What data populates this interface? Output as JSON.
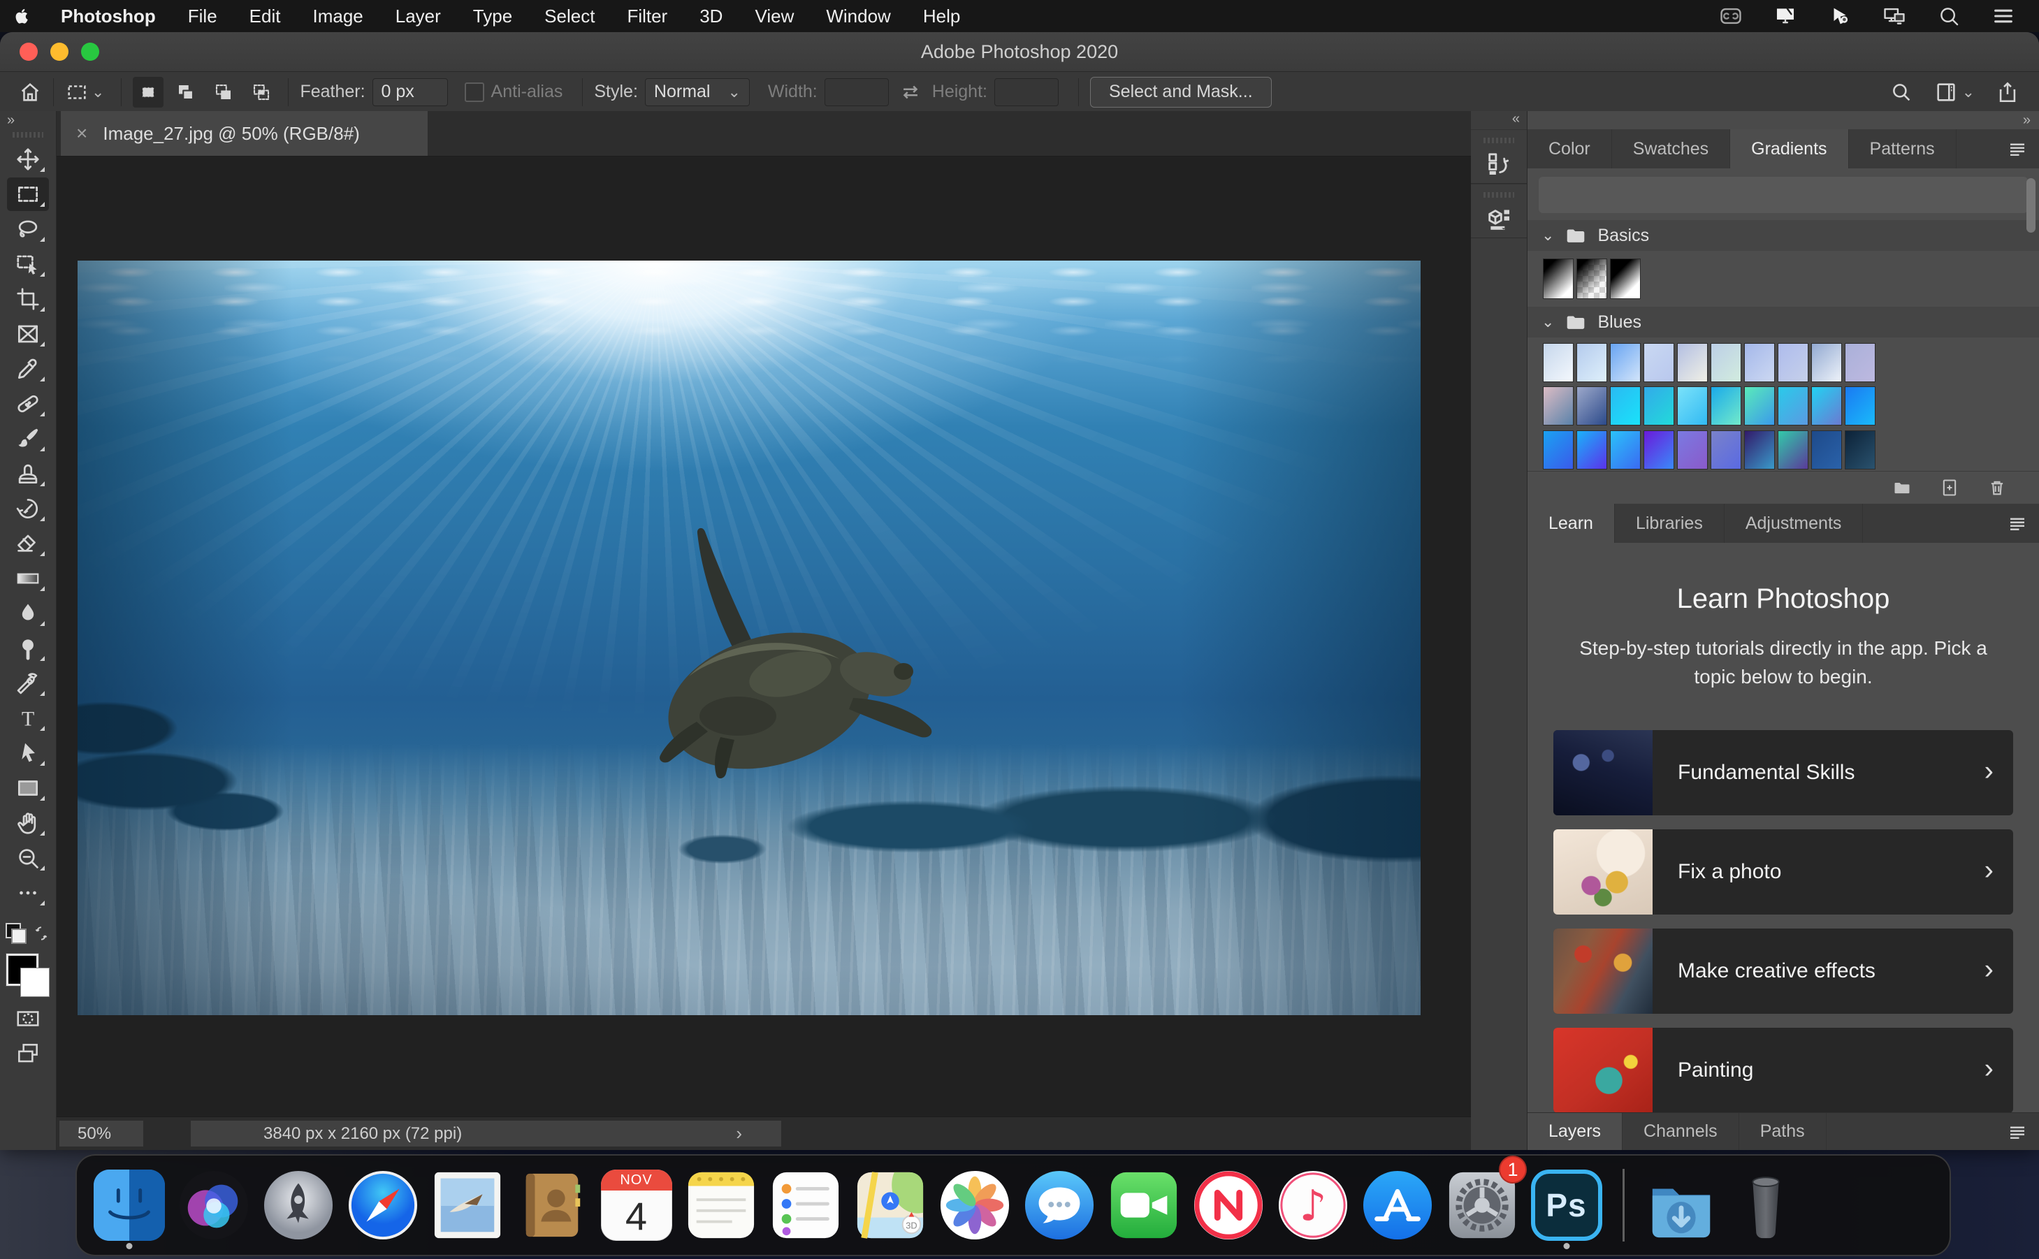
{
  "menubar": {
    "items": [
      "Photoshop",
      "File",
      "Edit",
      "Image",
      "Layer",
      "Type",
      "Select",
      "Filter",
      "3D",
      "View",
      "Window",
      "Help"
    ],
    "status_icons": [
      "creative-cloud-icon",
      "display-mirroring-icon",
      "pen-input-icon",
      "external-displays-icon",
      "spotlight-search-icon",
      "notification-list-icon"
    ]
  },
  "titlebar": {
    "title": "Adobe Photoshop 2020"
  },
  "optionsbar": {
    "feather_label": "Feather:",
    "feather_value": "0 px",
    "antialias_label": "Anti-alias",
    "style_label": "Style:",
    "style_value": "Normal",
    "width_label": "Width:",
    "height_label": "Height:",
    "select_and_mask_label": "Select and Mask...",
    "selection_modes": [
      "new-selection",
      "add-to-selection",
      "subtract-from-selection",
      "intersect-selection"
    ]
  },
  "document": {
    "tab_title": "Image_27.jpg @ 50% (RGB/8#)",
    "close_glyph": "×"
  },
  "toolbar": {
    "tools": [
      {
        "name": "move-tool",
        "selected": false
      },
      {
        "name": "rectangular-marquee-tool",
        "selected": true
      },
      {
        "name": "lasso-tool",
        "selected": false
      },
      {
        "name": "object-selection-tool",
        "selected": false
      },
      {
        "name": "crop-tool",
        "selected": false
      },
      {
        "name": "frame-tool",
        "selected": false
      },
      {
        "name": "eyedropper-tool",
        "selected": false
      },
      {
        "name": "spot-healing-brush-tool",
        "selected": false
      },
      {
        "name": "brush-tool",
        "selected": false
      },
      {
        "name": "clone-stamp-tool",
        "selected": false
      },
      {
        "name": "history-brush-tool",
        "selected": false
      },
      {
        "name": "eraser-tool",
        "selected": false
      },
      {
        "name": "gradient-tool",
        "selected": false
      },
      {
        "name": "blur-tool",
        "selected": false
      },
      {
        "name": "dodge-tool",
        "selected": false
      },
      {
        "name": "pen-tool",
        "selected": false
      },
      {
        "name": "type-tool",
        "selected": false
      },
      {
        "name": "path-selection-tool",
        "selected": false
      },
      {
        "name": "rectangle-tool",
        "selected": false
      },
      {
        "name": "hand-tool",
        "selected": false
      },
      {
        "name": "zoom-tool",
        "selected": false
      },
      {
        "name": "edit-toolbar",
        "selected": false
      }
    ]
  },
  "statusbar": {
    "zoom_value": "50%",
    "doc_info": "3840 px x 2160 px (72 ppi)"
  },
  "gradients_panel": {
    "tabs": [
      "Color",
      "Swatches",
      "Gradients",
      "Patterns"
    ],
    "active_tab": "Gradients",
    "basics_label": "Basics",
    "basics_items": [
      "black-to-white",
      "black-to-transparent",
      "black-to-white-hard"
    ],
    "blues_label": "Blues",
    "blues_swatches": [
      [
        "#c6d7ec",
        "#f4f8fd"
      ],
      [
        "#b4cbed",
        "#dff0fb"
      ],
      [
        "#68a4f2",
        "#d3e5fa"
      ],
      [
        "#c9d8f2",
        "#b9c8ee"
      ],
      [
        "#b3bfe2",
        "#f0f0e6"
      ],
      [
        "#bccfe6",
        "#d2ecdf"
      ],
      [
        "#a5b8ea",
        "#ccd8f2"
      ],
      [
        "#aebced",
        "#c6d0ea"
      ],
      [
        "#92a9d1",
        "#eef3fa"
      ],
      [
        "#aab0d9",
        "#bdb9e0"
      ],
      [
        "#dcbcc4",
        "#5a82aa"
      ],
      [
        "#9ca8ca",
        "#2c4a8a"
      ],
      [
        "#2abaf2",
        "#1ae2fa"
      ],
      [
        "#32aaea",
        "#22dada"
      ],
      [
        "#7ae2fa",
        "#32baf2"
      ],
      [
        "#1aaaea",
        "#72eaca"
      ],
      [
        "#5aeaba",
        "#3a9aea"
      ],
      [
        "#2acaea",
        "#5a9ae2"
      ],
      [
        "#22d2f2",
        "#6a7ad2"
      ],
      [
        "#1a7af2",
        "#1abafa"
      ],
      [
        "#1aa2f2",
        "#3a5aea"
      ],
      [
        "#1ab2fa",
        "#5a32ea"
      ],
      [
        "#2ac2fa",
        "#3a6af2"
      ],
      [
        "#6a1ada",
        "#3a8afa"
      ],
      [
        "#7a7ae2",
        "#8a5aca"
      ],
      [
        "#7a82ca",
        "#5a6ae2"
      ],
      [
        "#321a6a",
        "#3a9aca"
      ],
      [
        "#32caaa",
        "#5a3a9a"
      ],
      [
        "#1e4a8a",
        "#2a62aa"
      ],
      [
        "#0c2238",
        "#2a526e"
      ]
    ]
  },
  "learn_panel": {
    "tabs": [
      "Learn",
      "Libraries",
      "Adjustments"
    ],
    "active_tab": "Learn",
    "heading": "Learn Photoshop",
    "subtitle": "Step-by-step tutorials directly in the app. Pick a topic below to begin.",
    "cards": [
      {
        "title": "Fundamental Skills"
      },
      {
        "title": "Fix a photo"
      },
      {
        "title": "Make creative effects"
      },
      {
        "title": "Painting"
      }
    ]
  },
  "layers_panel": {
    "tabs": [
      "Layers",
      "Channels",
      "Paths"
    ],
    "active_tab": "Layers"
  },
  "collapsed_panels": [
    "history-panel-icon",
    "properties-panel-icon"
  ],
  "dock": {
    "items": [
      {
        "name": "finder",
        "running": true
      },
      {
        "name": "siri"
      },
      {
        "name": "launchpad"
      },
      {
        "name": "safari"
      },
      {
        "name": "mail"
      },
      {
        "name": "contacts"
      },
      {
        "name": "calendar",
        "month": "NOV",
        "day": "4"
      },
      {
        "name": "notes"
      },
      {
        "name": "reminders"
      },
      {
        "name": "maps"
      },
      {
        "name": "photos"
      },
      {
        "name": "messages"
      },
      {
        "name": "facetime"
      },
      {
        "name": "news"
      },
      {
        "name": "music"
      },
      {
        "name": "app-store"
      },
      {
        "name": "system-preferences",
        "badge": "1"
      },
      {
        "name": "photoshop",
        "label": "Ps",
        "running": true,
        "selected": true
      },
      {
        "name": "separator"
      },
      {
        "name": "downloads"
      },
      {
        "name": "trash"
      }
    ]
  },
  "glyphs": {
    "panel_collapse": "«",
    "panel_expand": "»",
    "chevron_right": "›",
    "dropdown": "⌄"
  },
  "colors": {
    "accent_blue": "#3ab4f2",
    "badge_red": "#ec3b2f",
    "panel_bg": "#4d4d4d",
    "tabbar_bg": "#3a3a3a",
    "canvas_bg": "#212121"
  }
}
